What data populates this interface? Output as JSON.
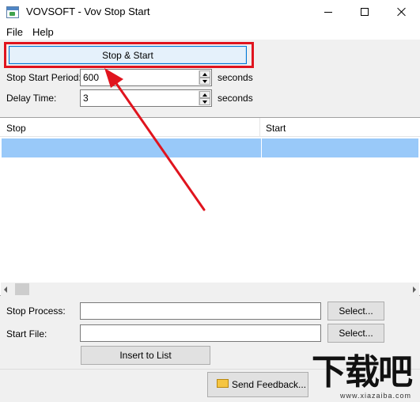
{
  "window": {
    "title": "VOVSOFT - Vov Stop Start"
  },
  "menu": {
    "file": "File",
    "help": "Help"
  },
  "toolbar": {
    "stop_start_label": "Stop & Start"
  },
  "settings": {
    "period_label": "Stop Start Period:",
    "period_value": "600",
    "period_unit": "seconds",
    "delay_label": "Delay Time:",
    "delay_value": "3",
    "delay_unit": "seconds"
  },
  "list": {
    "columns": [
      "Stop",
      "Start"
    ],
    "rows": [
      {
        "stop": "",
        "start": ""
      }
    ]
  },
  "form": {
    "stop_process_label": "Stop Process:",
    "stop_process_value": "",
    "start_file_label": "Start File:",
    "start_file_value": "",
    "select_label": "Select...",
    "insert_label": "Insert to List"
  },
  "footer": {
    "feedback_label": "Send Feedback..."
  },
  "watermark": {
    "cn": "下载吧",
    "en": "www.xiazaiba.com"
  },
  "colors": {
    "highlight": "#e0141e",
    "selection": "#99c9f9",
    "accent": "#0078d7"
  },
  "icons": {
    "app": "app-window-icon",
    "feedback": "envelope-icon"
  }
}
